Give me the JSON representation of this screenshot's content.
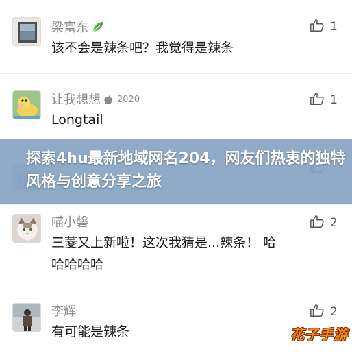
{
  "comments": [
    {
      "username": "梁富东",
      "badge": "",
      "text": "该不会是辣条吧？我觉得是辣条",
      "likes": "1"
    },
    {
      "username": "让我想想",
      "badge": "2020",
      "text": "Longtail",
      "likes": "1"
    },
    {
      "username": "",
      "badge": "",
      "text": "",
      "likes": ""
    },
    {
      "username": "喵小磐",
      "badge": "",
      "text_line1": "三菱又上新啦！这次我猜是...辣条！ 哈",
      "text_line2": "哈哈哈哈",
      "likes": "2"
    },
    {
      "username": "李辉",
      "badge": "",
      "text": "有可能是辣条",
      "likes": "2"
    }
  ],
  "banner": {
    "title": "探索4hu最新地域网名204，网友们热衷的独特风格与创意分享之旅"
  },
  "watermark": {
    "text": "花子手游"
  },
  "colors": {
    "banner_bg": "#87a5c3",
    "username": "#8a8a8a",
    "leaf": "#5aa84a",
    "watermark": "#f28a1c"
  }
}
